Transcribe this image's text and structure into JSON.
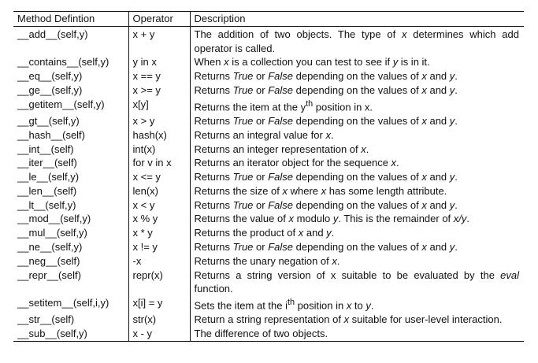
{
  "table": {
    "headers": {
      "method": "Method Defintion",
      "operator": "Operator",
      "description": "Description"
    },
    "rows": [
      {
        "method": "__add__(self,y)",
        "operator": "x + y",
        "description": "The addition of two objects. The type of <i>x</i> determines which add operator is called."
      },
      {
        "method": "__contains__(self,y)",
        "operator": "y in x",
        "description": "When <i>x</i> is a collection you can test to see if <i>y</i> is in it."
      },
      {
        "method": "__eq__(self,y)",
        "operator": "x == y",
        "description": "Returns <i>True</i> or <i>False</i> depending on the values of <i>x</i> and <i>y</i>."
      },
      {
        "method": "__ge__(self,y)",
        "operator": "x >= y",
        "description": "Returns <i>True</i> or <i>False</i> depending on the values of <i>x</i> and <i>y</i>."
      },
      {
        "method": "__getitem__(self,y)",
        "operator": "x[y]",
        "description": "Returns the item at the y<sup>th</sup> position in x."
      },
      {
        "method": "__gt__(self,y)",
        "operator": "x > y",
        "description": "Returns <i>True</i> or <i>False</i> depending on the values of <i>x</i> and <i>y</i>."
      },
      {
        "method": "__hash__(self)",
        "operator": "hash(x)",
        "description": "Returns an integral value for <i>x</i>."
      },
      {
        "method": "__int__(self)",
        "operator": "int(x)",
        "description": "Returns an integer representation of <i>x</i>."
      },
      {
        "method": "__iter__(self)",
        "operator": "for v in x",
        "description": "Returns an iterator object for the sequence <i>x</i>."
      },
      {
        "method": "__le__(self,y)",
        "operator": "x <= y",
        "description": "Returns <i>True</i> or <i>False</i> depending on the values of <i>x</i> and <i>y</i>."
      },
      {
        "method": "__len__(self)",
        "operator": "len(x)",
        "description": "Returns the size of <i>x</i> where <i>x</i> has some length attribute."
      },
      {
        "method": "__lt__(self,y)",
        "operator": "x < y",
        "description": "Returns <i>True</i> or <i>False</i> depending on the values of <i>x</i> and <i>y</i>."
      },
      {
        "method": "__mod__(self,y)",
        "operator": "x % y",
        "description": "Returns the value of <i>x</i> modulo <i>y</i>. This is the remainder of <i>x/y</i>."
      },
      {
        "method": "__mul__(self,y)",
        "operator": "x * y",
        "description": "Returns the product of <i>x</i> and <i>y</i>."
      },
      {
        "method": "__ne__(self,y)",
        "operator": "x != y",
        "description": "Returns <i>True</i> or <i>False</i> depending on the values of <i>x</i> and <i>y</i>."
      },
      {
        "method": "__neg__(self)",
        "operator": "-x",
        "description": "Returns the unary negation of <i>x</i>."
      },
      {
        "method": "__repr__(self)",
        "operator": "repr(x)",
        "description": "Returns a string version of x suitable to be evaluated by the <i>eval</i> function."
      },
      {
        "method": "__setitem__(self,i,y)",
        "operator": "x[i] = y",
        "description": "Sets the item at the i<sup>th</sup> position in <i>x</i> to <i>y</i>."
      },
      {
        "method": "__str__(self)",
        "operator": "str(x)",
        "description": "Return a string representation of <i>x</i> suitable for user-level interaction."
      },
      {
        "method": "__sub__(self,y)",
        "operator": "x - y",
        "description": "The difference of two objects."
      }
    ]
  }
}
